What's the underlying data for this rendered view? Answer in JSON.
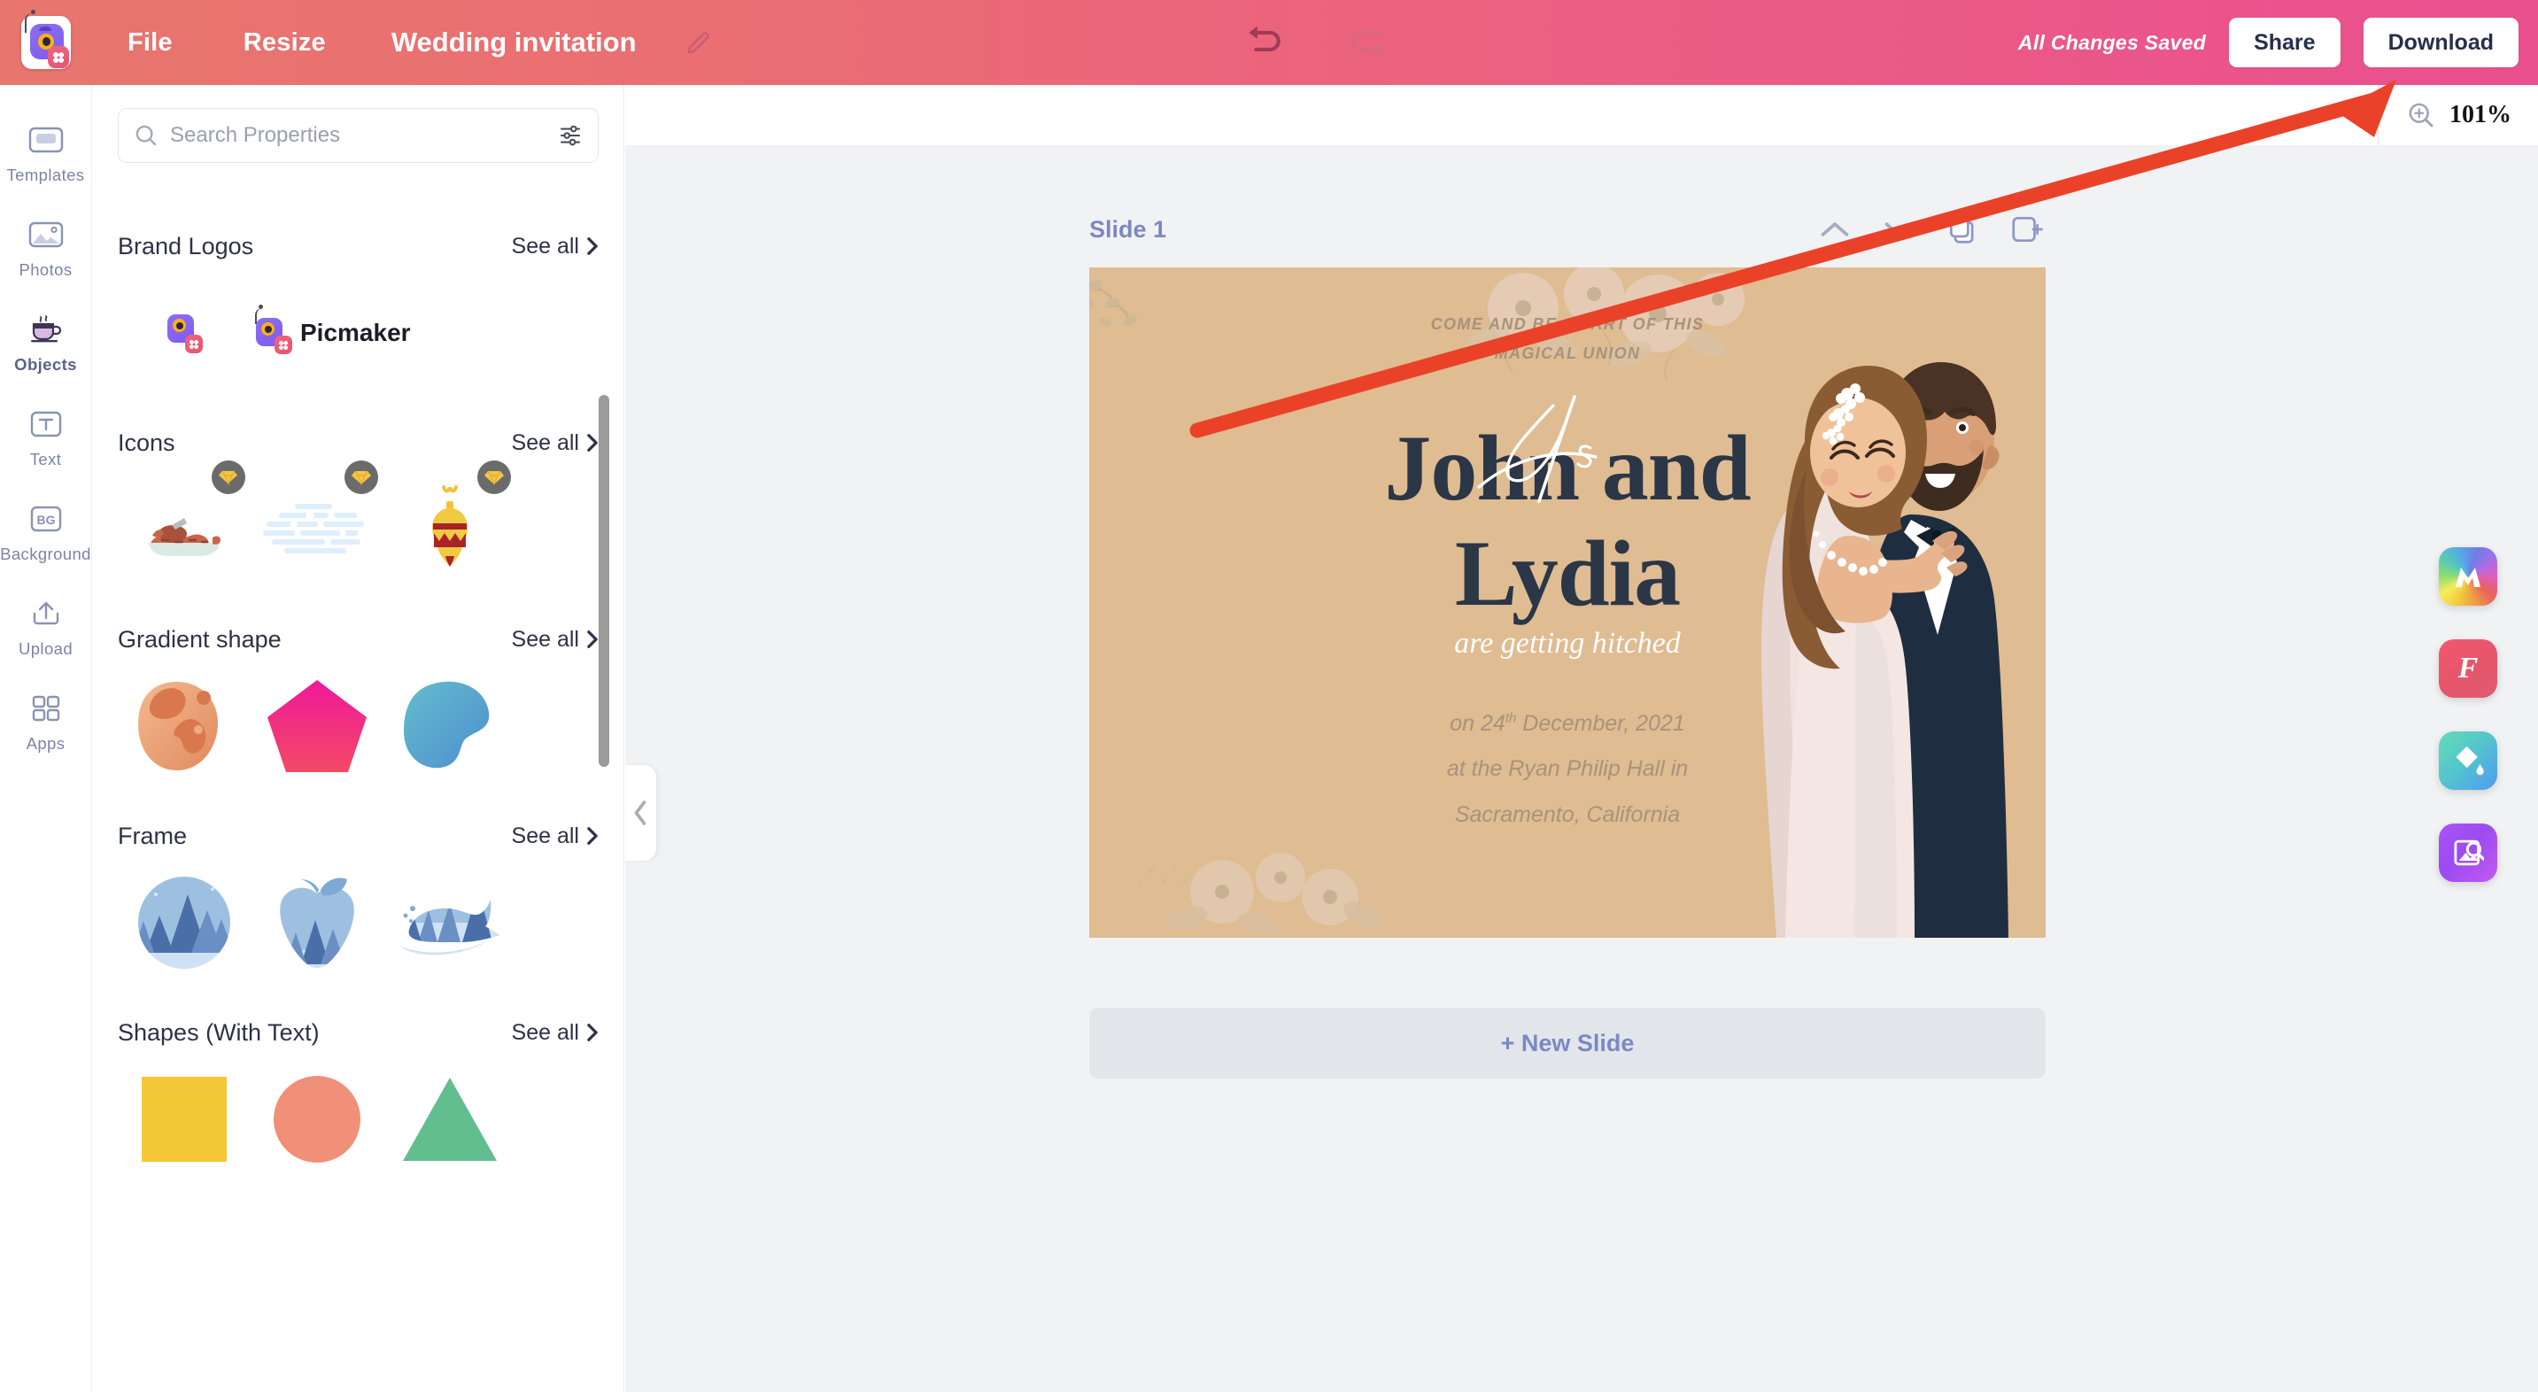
{
  "app": {
    "brand": "Picmaker",
    "logo_icon": "picmaker-logo-icon"
  },
  "topbar": {
    "menu": [
      {
        "label": "File",
        "name": "menu-file"
      },
      {
        "label": "Resize",
        "name": "menu-resize"
      }
    ],
    "document_title": "Wedding invitation",
    "rename_icon": "pencil-icon",
    "undo_icon": "undo-icon",
    "redo_icon": "redo-icon",
    "save_status": "All Changes Saved",
    "share_label": "Share",
    "download_label": "Download",
    "bg_from": "#e8766e",
    "bg_to": "#ea4f8f"
  },
  "rail": {
    "items": [
      {
        "label": "Templates",
        "icon": "templates-icon",
        "active": false
      },
      {
        "label": "Photos",
        "icon": "photos-icon",
        "active": false
      },
      {
        "label": "Objects",
        "icon": "objects-cup-icon",
        "active": true
      },
      {
        "label": "Text",
        "icon": "text-icon",
        "active": false
      },
      {
        "label": "Background",
        "icon": "background-icon",
        "active": false
      },
      {
        "label": "Upload",
        "icon": "upload-icon",
        "active": false
      },
      {
        "label": "Apps",
        "icon": "apps-grid-icon",
        "active": false
      }
    ]
  },
  "panel": {
    "search": {
      "placeholder": "Search Properties",
      "value": "",
      "search_icon": "search-icon",
      "filter_icon": "filter-sliders-icon"
    },
    "see_all_label": "See all",
    "sections": [
      {
        "title": "Brand Logos",
        "name": "section-brand-logos",
        "items": [
          {
            "name": "brand-logo-mark",
            "kind": "logo-mark"
          },
          {
            "name": "brand-logo-full",
            "kind": "logo-wordmark",
            "label": "Picmaker"
          }
        ]
      },
      {
        "title": "Icons",
        "name": "section-icons",
        "items": [
          {
            "name": "icon-roast-dish",
            "kind": "roast",
            "pro": true
          },
          {
            "name": "icon-snow-clouds",
            "kind": "snow",
            "pro": true
          },
          {
            "name": "icon-christmas-bauble",
            "kind": "bauble",
            "pro": true
          }
        ]
      },
      {
        "title": "Gradient shape",
        "name": "section-gradient-shape",
        "items": [
          {
            "name": "gradient-blob-orange",
            "kind": "blob-orange"
          },
          {
            "name": "gradient-pentagon-pink",
            "kind": "pentagon-pink"
          },
          {
            "name": "gradient-blob-blue",
            "kind": "blob-blue"
          }
        ]
      },
      {
        "title": "Frame",
        "name": "section-frame",
        "items": [
          {
            "name": "frame-circle-forest",
            "kind": "frame-circle"
          },
          {
            "name": "frame-apple-forest",
            "kind": "frame-apple"
          },
          {
            "name": "frame-whale-forest",
            "kind": "frame-whale"
          }
        ]
      },
      {
        "title": "Shapes (With Text)",
        "name": "section-shapes-with-text",
        "items": [
          {
            "name": "shape-square-yellow",
            "kind": "square",
            "color": "#f4c836"
          },
          {
            "name": "shape-circle-salmon",
            "kind": "circle",
            "color": "#f19078"
          },
          {
            "name": "shape-triangle-green",
            "kind": "triangle",
            "color": "#62bd8f"
          }
        ]
      }
    ]
  },
  "stage": {
    "zoom_label": "101%",
    "zoom_icon": "zoom-in-icon",
    "collapse_icon": "chevron-left-icon",
    "slide": {
      "label": "Slide 1",
      "tools": [
        {
          "name": "move-slide-up-button",
          "icon": "chevron-up-icon"
        },
        {
          "name": "move-slide-down-button",
          "icon": "chevron-down-icon"
        },
        {
          "name": "duplicate-slide-button",
          "icon": "duplicate-icon"
        },
        {
          "name": "add-slide-button",
          "icon": "add-page-icon"
        }
      ]
    },
    "new_slide_label": "+ New Slide"
  },
  "invitation": {
    "kicker_line1": "COME AND BE A PART OF THIS",
    "kicker_line2": "MAGICAL UNION",
    "ampersand_script": "As",
    "name_line1": "John and",
    "name_line2": "Lydia",
    "subtitle_script": "are getting hitched",
    "date_prefix": "on 24",
    "date_ordinal": "th",
    "date_rest": " December, 2021",
    "venue_line": "at the Ryan Philip Hall in",
    "city_line": "Sacramento, California",
    "bg_color": "#dfbc91",
    "name_color": "#2b3647",
    "muted_color": "#a8937d"
  },
  "floating_apps": [
    {
      "name": "magic-resize-app-button",
      "icon": "rainbow-m-icon"
    },
    {
      "name": "fonts-app-button",
      "icon": "script-f-icon"
    },
    {
      "name": "color-fill-app-button",
      "icon": "paint-bucket-icon"
    },
    {
      "name": "image-search-app-button",
      "icon": "image-search-icon"
    }
  ],
  "annotation": {
    "arrow_color": "#ea4228",
    "target": "download-button"
  }
}
